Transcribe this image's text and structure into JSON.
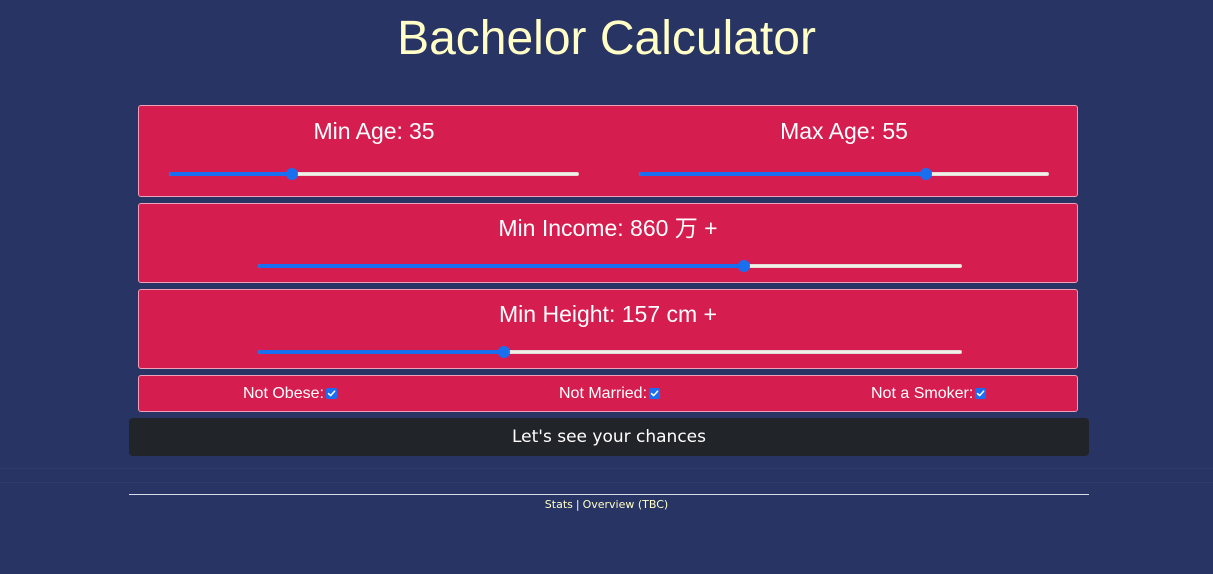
{
  "header": {
    "title": "Bachelor Calculator"
  },
  "filters": {
    "min_age": {
      "label": "Min Age:",
      "value": "35",
      "slider_fraction": 0.3
    },
    "max_age": {
      "label": "Max Age: 55",
      "slider_fraction": 0.7
    },
    "min_income": {
      "label": "Min Income: 860 万 +",
      "slider_fraction": 0.69
    },
    "min_height": {
      "label": "Min Height: 157 cm +",
      "slider_fraction": 0.35
    }
  },
  "checks": {
    "not_obese": {
      "label": "Not Obese:",
      "checked": true
    },
    "not_married": {
      "label": "Not Married:",
      "checked": true
    },
    "not_smoker": {
      "label": "Not a Smoker:",
      "checked": true
    }
  },
  "actions": {
    "submit_label": "Let's see your chances"
  },
  "footer": {
    "stats_link": "Stats",
    "separator": "|",
    "overview_link": "Overview (TBC)"
  },
  "colors": {
    "background": "#283463",
    "card": "#d51d4f",
    "accent": "#1a6ff0",
    "title": "#ffffc7",
    "button": "#212429"
  }
}
